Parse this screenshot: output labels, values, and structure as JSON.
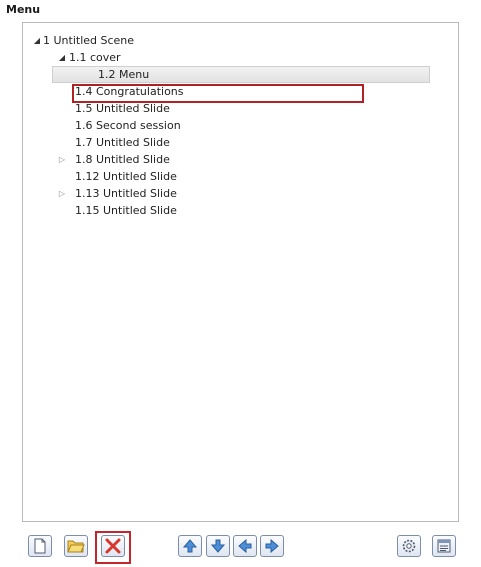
{
  "panel_title": "Menu",
  "tree": [
    {
      "label": "1 Untitled Scene",
      "toggle": "expanded"
    },
    {
      "label": "1.1 cover",
      "toggle": "expanded"
    },
    {
      "label": "1.2 Menu",
      "toggle": "none"
    },
    {
      "label": "1.4 Congratulations",
      "toggle": "none",
      "selected": true
    },
    {
      "label": "1.5 Untitled Slide",
      "toggle": "none"
    },
    {
      "label": "1.6 Second session",
      "toggle": "none"
    },
    {
      "label": "1.7 Untitled Slide",
      "toggle": "none"
    },
    {
      "label": "1.8 Untitled Slide",
      "toggle": "collapsed"
    },
    {
      "label": "1.12 Untitled Slide",
      "toggle": "none"
    },
    {
      "label": "1.13 Untitled Slide",
      "toggle": "collapsed"
    },
    {
      "label": "1.15 Untitled Slide",
      "toggle": "none"
    }
  ],
  "toolbar": {
    "buttons": [
      {
        "icon": "new-page-icon"
      },
      {
        "icon": "open-folder-icon"
      },
      {
        "icon": "delete-icon",
        "highlighted": true
      },
      {
        "icon": "move-top-icon"
      },
      {
        "icon": "move-down-icon"
      },
      {
        "icon": "move-left-icon"
      },
      {
        "icon": "move-right-icon"
      },
      {
        "icon": "settings-icon"
      },
      {
        "icon": "properties-icon"
      }
    ]
  },
  "colors": {
    "highlight_outline": "#b02126",
    "selection_background": "#e8e8e8",
    "button_border": "#7d8ea9"
  }
}
